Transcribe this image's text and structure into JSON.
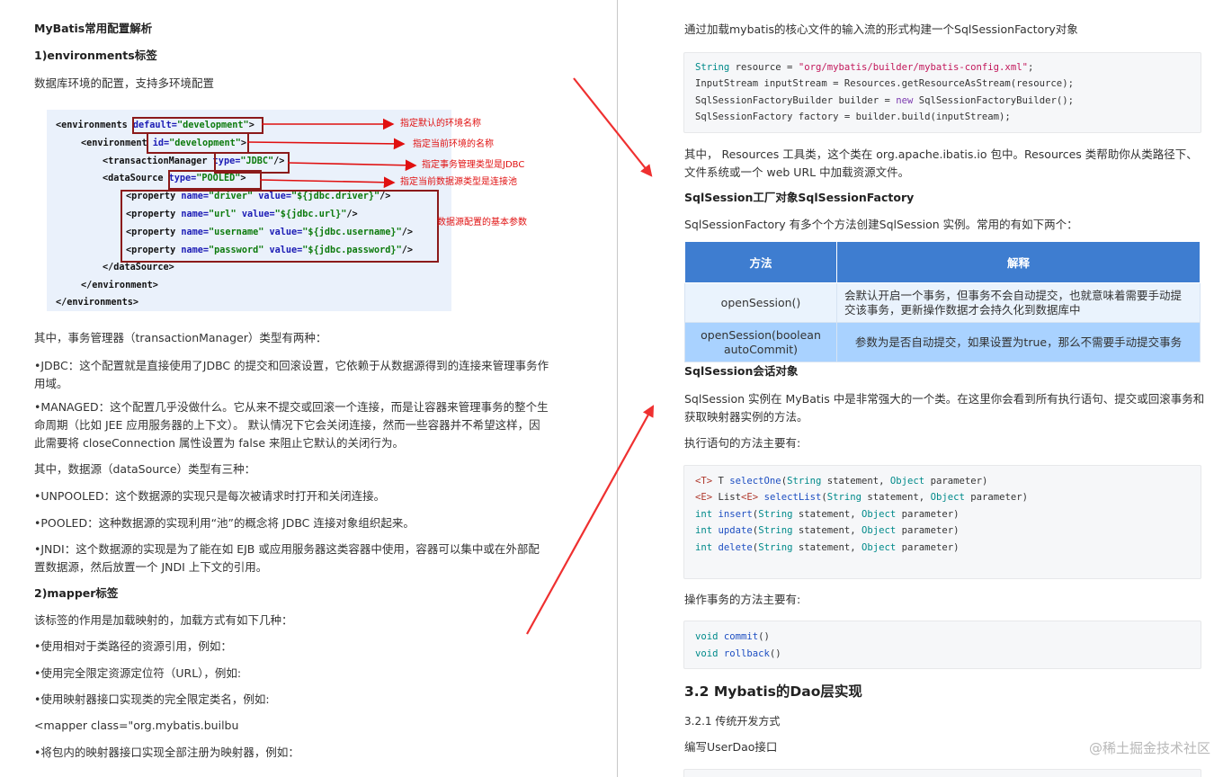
{
  "left": {
    "title": "MyBatis常用配置解析",
    "env_heading": "1)environments标签",
    "env_desc": "数据库环境的配置，支持多环境配置",
    "xml": {
      "l1_tag": "<environments ",
      "l1_attr": "default=",
      "l1_val": "\"development\"",
      "l1_end": ">",
      "l2_tag": "<environment ",
      "l2_attr": "id=",
      "l2_val": "\"development\"",
      "l2_end": ">",
      "l3_tag": "<transactionManager ",
      "l3_attr": "type=",
      "l3_val": "\"JDBC\"",
      "l3_end": "/>",
      "l4_tag": "<dataSource ",
      "l4_attr": "type=",
      "l4_val": "\"POOLED\"",
      "l4_end": ">",
      "p1_tag": "<property ",
      "p1_a1": "name=",
      "p1_v1": "\"driver\"",
      "p1_a2": " value=",
      "p1_v2": "\"${jdbc.driver}\"",
      "p1_end": "/>",
      "p2_tag": "<property ",
      "p2_a1": "name=",
      "p2_v1": "\"url\"",
      "p2_a2": " value=",
      "p2_v2": "\"${jdbc.url}\"",
      "p2_end": "/>",
      "p3_tag": "<property ",
      "p3_a1": "name=",
      "p3_v1": "\"username\"",
      "p3_a2": " value=",
      "p3_v2": "\"${jdbc.username}\"",
      "p3_end": "/>",
      "p4_tag": "<property ",
      "p4_a1": "name=",
      "p4_v1": "\"password\"",
      "p4_a2": " value=",
      "p4_v2": "\"${jdbc.password}\"",
      "p4_end": "/>",
      "c1": "</dataSource>",
      "c2": "</environment>",
      "c3": "</environments>"
    },
    "annotations": {
      "a1": "指定默认的环境名称",
      "a2": "指定当前环境的名称",
      "a3": "指定事务管理类型是JDBC",
      "a4": "指定当前数据源类型是连接池",
      "a5": "数据源配置的基本参数"
    },
    "tm_intro": "其中，事务管理器（transactionManager）类型有两种：",
    "tm_jdbc": "•JDBC：这个配置就是直接使用了JDBC 的提交和回滚设置，它依赖于从数据源得到的连接来管理事务作用域。",
    "tm_managed": "•MANAGED：这个配置几乎没做什么。它从来不提交或回滚一个连接，而是让容器来管理事务的整个生命周期（比如 JEE 应用服务器的上下文）。 默认情况下它会关闭连接，然而一些容器并不希望这样，因此需要将 closeConnection 属性设置为 false 来阻止它默认的关闭行为。",
    "ds_intro": "其中，数据源（dataSource）类型有三种：",
    "ds_unpooled": "•UNPOOLED：这个数据源的实现只是每次被请求时打开和关闭连接。",
    "ds_pooled": "•POOLED：这种数据源的实现利用“池”的概念将 JDBC 连接对象组织起来。",
    "ds_jndi": "•JNDI：这个数据源的实现是为了能在如 EJB 或应用服务器这类容器中使用，容器可以集中或在外部配置数据源，然后放置一个 JNDI 上下文的引用。",
    "mapper_heading": "2)mapper标签",
    "mapper_desc": "该标签的作用是加载映射的，加载方式有如下几种：",
    "m1": "•使用相对于类路径的资源引用，例如：",
    "m2": "•使用完全限定资源定位符（URL），例如:",
    "m3": "•使用映射器接口实现类的完全限定类名，例如:",
    "m4": "<mapper class=\"org.mybatis.builbu",
    "m5": "•将包内的映射器接口实现全部注册为映射器，例如："
  },
  "right": {
    "intro": "通过加载mybatis的核心文件的输入流的形式构建一个SqlSessionFactory对象",
    "code1": {
      "l1_t": "String",
      "l1_v": " resource = ",
      "l1_s": "\"org/mybatis/builder/mybatis-config.xml\"",
      "l1_e": ";",
      "l2": "InputStream inputStream = Resources.getResourceAsStream(resource);",
      "l3_a": "SqlSessionFactoryBuilder builder = ",
      "l3_k": "new",
      "l3_b": " SqlSessionFactoryBuilder();",
      "l4": "SqlSessionFactory factory = builder.build(inputStream);"
    },
    "resources_desc": "其中， Resources 工具类，这个类在 org.apache.ibatis.io 包中。Resources 类帮助你从类路径下、文件系统或一个 web URL 中加载资源文件。",
    "factory_heading": "SqlSession工厂对象SqlSessionFactory",
    "factory_desc": "SqlSessionFactory 有多个个方法创建SqlSession 实例。常用的有如下两个：",
    "table": {
      "h1": "方法",
      "h2": "解释",
      "r1c1": "openSession()",
      "r1c2": "会默认开启一个事务，但事务不会自动提交，也就意味着需要手动提交该事务，更新操作数据才会持久化到数据库中",
      "r2c1": "openSession(boolean autoCommit)",
      "r2c2": "参数为是否自动提交，如果设置为true，那么不需要手动提交事务"
    },
    "session_heading": "SqlSession会话对象",
    "session_desc": "SqlSession 实例在 MyBatis 中是非常强大的一个类。在这里你会看到所有执行语句、提交或回滚事务和获取映射器实例的方法。",
    "exec_label": "执行语句的方法主要有:",
    "code2": {
      "l1_g": "<T>",
      "l1_a": " T ",
      "l1_f": "selectOne",
      "l1_p": "(",
      "l1_t1": "String",
      "l1_m": " statement, ",
      "l1_t2": "Object",
      "l1_e": " parameter)",
      "l2_g": "<E>",
      "l2_a": " List",
      "l2_g2": "<E>",
      "l2_s": " ",
      "l2_f": "selectList",
      "l2_p": "(",
      "l2_t1": "String",
      "l2_m": " statement, ",
      "l2_t2": "Object",
      "l2_e": " parameter)",
      "l3_k": "int",
      "l3_f": " insert",
      "l3_p": "(",
      "l3_t1": "String",
      "l3_m": " statement, ",
      "l3_t2": "Object",
      "l3_e": " parameter)",
      "l4_k": "int",
      "l4_f": " update",
      "l4_p": "(",
      "l4_t1": "String",
      "l4_m": " statement, ",
      "l4_t2": "Object",
      "l4_e": " parameter)",
      "l5_k": "int",
      "l5_f": " delete",
      "l5_p": "(",
      "l5_t1": "String",
      "l5_m": " statement, ",
      "l5_t2": "Object",
      "l5_e": " parameter)"
    },
    "tx_label": "操作事务的方法主要有:",
    "code3": {
      "l1_k": "void",
      "l1_f": " commit",
      "l1_e": "()",
      "l2_k": "void",
      "l2_f": " rollback",
      "l2_e": "()"
    },
    "dao_heading": "3.2 Mybatis的Dao层实现",
    "dao_sub": "3.2.1 传统开发方式",
    "dao_write": "编写UserDao接口"
  },
  "watermark": "@稀土掘金技术社区",
  "colors": {
    "annotation_red": "#e01010",
    "table_header": "#3e7dd0",
    "box_border": "#8b1a1a"
  }
}
